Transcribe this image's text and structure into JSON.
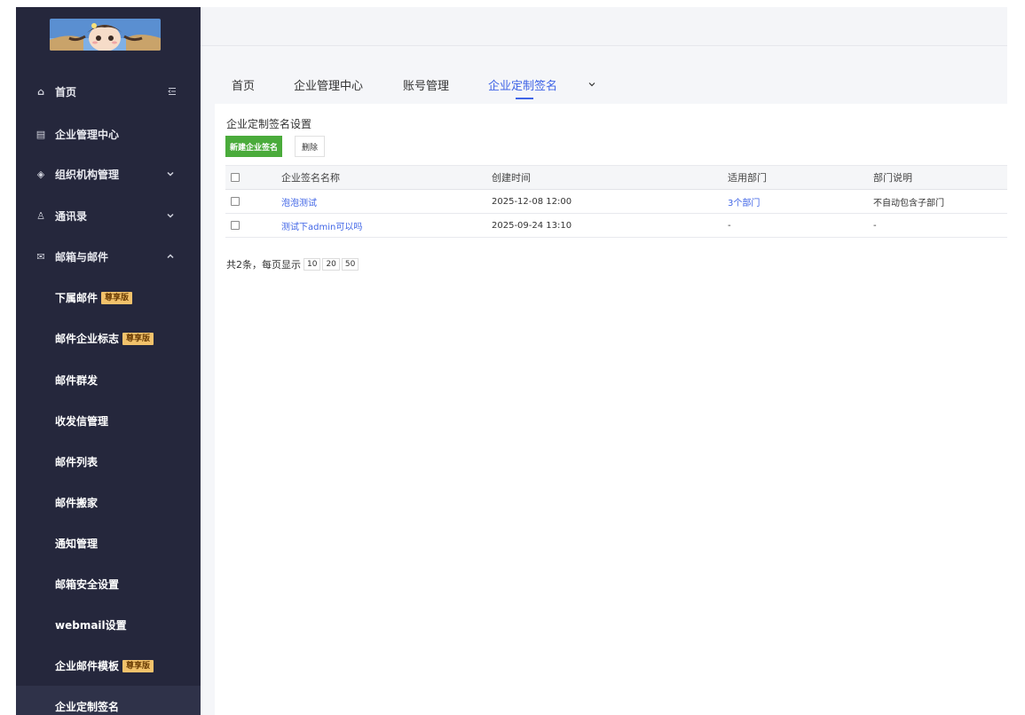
{
  "colors": {
    "sidebar_bg": "#25273c",
    "accent": "#3f64e6",
    "primary_button": "#4aab3b",
    "vip_badge": "#f2c26b"
  },
  "sidebar": {
    "logo_icon": "avatar-illustration-logo",
    "collapse_icon": "menu-collapse-icon",
    "items": [
      {
        "label": "首页",
        "icon": "home-icon",
        "glyph": "⌂"
      },
      {
        "label": "企业管理中心",
        "icon": "document-icon",
        "glyph": "▤"
      },
      {
        "label": "组织机构管理",
        "icon": "layers-icon",
        "glyph": "◈",
        "expandable": true
      },
      {
        "label": "通讯录",
        "icon": "contacts-icon",
        "glyph": "♙",
        "expandable": true
      },
      {
        "label": "邮箱与邮件",
        "icon": "mail-icon",
        "glyph": "✉",
        "expandable": true,
        "expanded": true
      }
    ],
    "sub_items": [
      {
        "label": "下属邮件",
        "badge": "尊享版"
      },
      {
        "label": "邮件企业标志",
        "badge": "尊享版"
      },
      {
        "label": "邮件群发"
      },
      {
        "label": "收发信管理"
      },
      {
        "label": "邮件列表"
      },
      {
        "label": "邮件搬家"
      },
      {
        "label": "通知管理"
      },
      {
        "label": "邮箱安全设置"
      },
      {
        "label": "webmail设置"
      },
      {
        "label": "企业邮件模板",
        "badge": "尊享版"
      },
      {
        "label": "企业定制签名",
        "active": true
      }
    ]
  },
  "tabs": {
    "items": [
      {
        "label": "首页"
      },
      {
        "label": "企业管理中心"
      },
      {
        "label": "账号管理"
      },
      {
        "label": "企业定制签名",
        "active": true
      }
    ],
    "more_icon": "chevron-down-icon"
  },
  "main": {
    "title": "企业定制签名设置",
    "new_button": "新建企业签名",
    "delete_button": "删除",
    "table": {
      "columns": [
        "企业签名名称",
        "创建时间",
        "适用部门",
        "部门说明"
      ],
      "rows": [
        {
          "name": "泡泡测试",
          "created": "2025-12-08 12:00",
          "departments": "3个部门",
          "description": "不自动包含子部门"
        },
        {
          "name": "测试下admin可以吗",
          "created": "2025-09-24 13:10",
          "departments": "-",
          "description": "-"
        }
      ]
    },
    "pagination": {
      "summary": "共2条，每页显示",
      "sizes": [
        "10",
        "20",
        "50"
      ]
    }
  }
}
